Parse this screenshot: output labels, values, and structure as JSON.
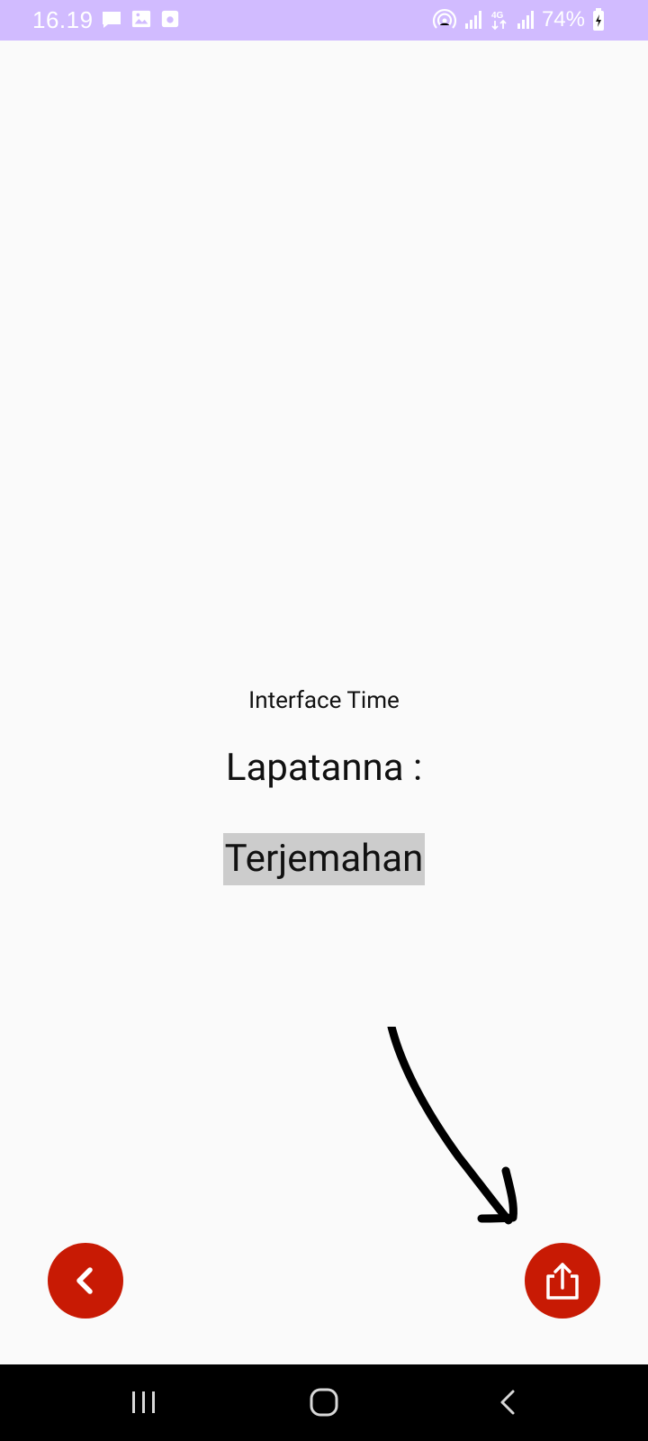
{
  "status_bar": {
    "time": "16.19",
    "battery": "74%",
    "network": "4G",
    "icons": [
      "message-icon",
      "image-icon",
      "camera-icon",
      "hotspot-icon",
      "signal-icon",
      "network-4g-icon",
      "signal-icon",
      "battery-charging-icon"
    ]
  },
  "content": {
    "subtitle": "Interface Time",
    "title": "Lapatanna :",
    "translation": "Terjemahan"
  },
  "buttons": {
    "back_icon": "chevron-left-icon",
    "share_icon": "share-icon"
  },
  "colors": {
    "status_bar": "#d1bbff",
    "accent": "#c81a04",
    "highlight": "#cccccc",
    "nav_bar": "#000000"
  }
}
